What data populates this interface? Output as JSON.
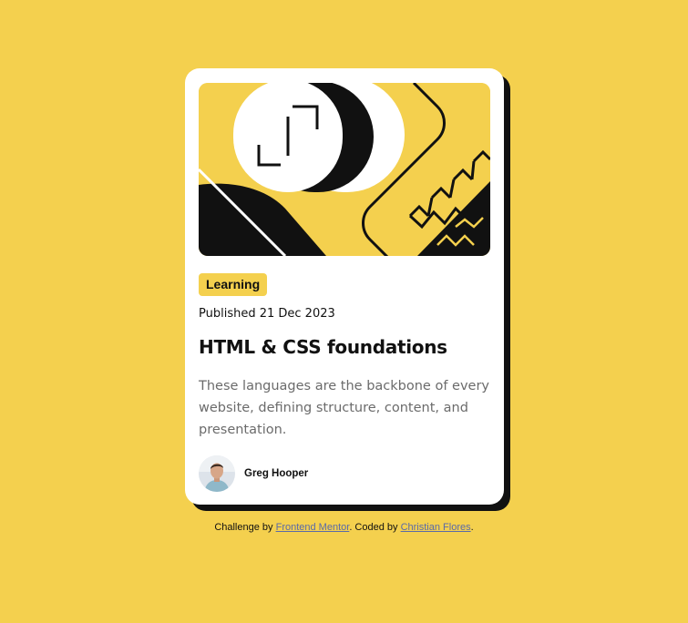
{
  "colors": {
    "background": "#F4D04E",
    "card": "#FFFFFF",
    "shadow": "#111111",
    "text": "#111111",
    "muted_text": "#6B6B6B",
    "link": "#5A6AA8"
  },
  "card": {
    "image_icon": "abstract-illustration",
    "tag": "Learning",
    "published": "Published 21 Dec 2023",
    "title": "HTML & CSS foundations",
    "description": "These languages are the backbone of every website, defining structure, content, and presentation.",
    "author": {
      "name": "Greg Hooper",
      "avatar_icon": "person-avatar"
    }
  },
  "attribution": {
    "prefix": "Challenge by ",
    "link1": "Frontend Mentor",
    "middle": ". Coded by ",
    "link2": "Christian Flores",
    "suffix": "."
  }
}
